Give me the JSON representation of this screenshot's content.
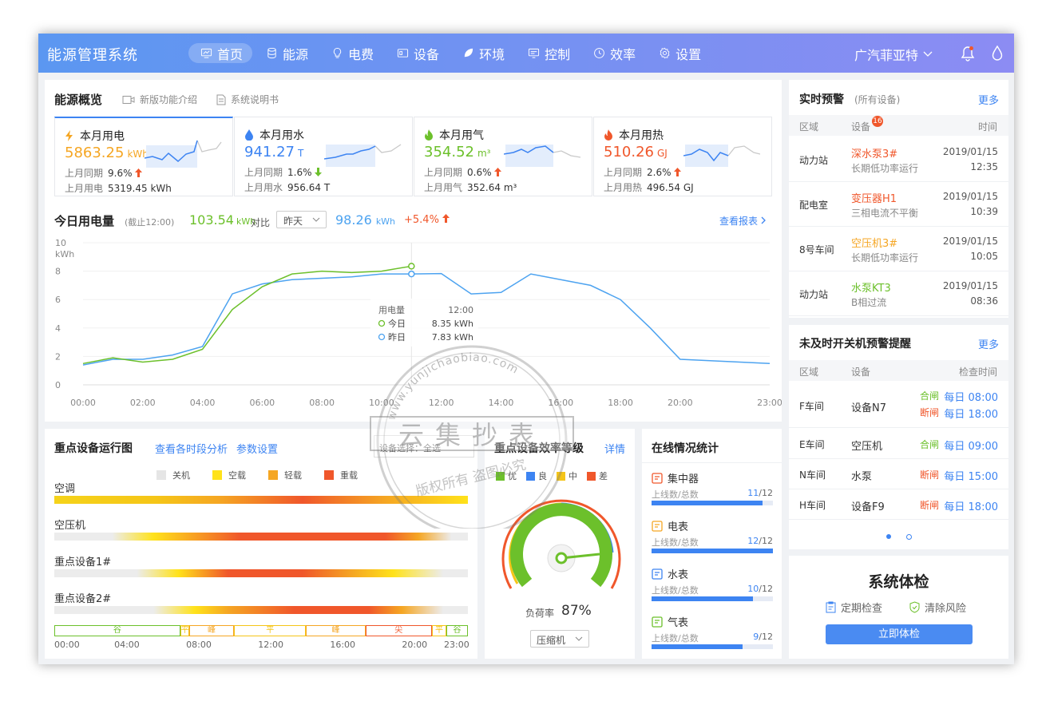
{
  "app": {
    "title": "能源管理系统",
    "user": "广汽菲亚特"
  },
  "nav": [
    "首页",
    "能源",
    "电费",
    "设备",
    "环境",
    "控制",
    "效率",
    "设置"
  ],
  "overview": {
    "title": "能源概览",
    "links": [
      "新版功能介绍",
      "系统说明书"
    ],
    "stats": [
      {
        "title": "本月用电",
        "value": "5863.25",
        "unit": "kWh",
        "color": "#f5a623",
        "yoy_label": "上月同期",
        "yoy": "9.6%",
        "yoy_dir": "up",
        "prev_label": "上月用电",
        "prev": "5319.45 kWh"
      },
      {
        "title": "本月用水",
        "value": "941.27",
        "unit": "T",
        "color": "#3d84f2",
        "yoy_label": "上月同期",
        "yoy": "1.6%",
        "yoy_dir": "down",
        "prev_label": "上月用水",
        "prev": "956.64 T"
      },
      {
        "title": "本月用气",
        "value": "354.52",
        "unit": "m³",
        "color": "#6cc02b",
        "yoy_label": "上月同期",
        "yoy": "0.6%",
        "yoy_dir": "up",
        "prev_label": "上月用气",
        "prev": "352.64 m³"
      },
      {
        "title": "本月用热",
        "value": "510.26",
        "unit": "GJ",
        "color": "#f0572b",
        "yoy_label": "上月同期",
        "yoy": "2.6%",
        "yoy_dir": "up",
        "prev_label": "上月用热",
        "prev": "496.54 GJ"
      }
    ]
  },
  "today": {
    "title": "今日用电量",
    "asof": "(截止12:00)",
    "today_val": "103.54",
    "unit": "kWh",
    "compare": "对比",
    "select": "昨天",
    "yest_val": "98.26",
    "pct": "+5.4%",
    "report": "查看报表"
  },
  "chart_data": {
    "type": "line",
    "ylabel": "kWh",
    "ylim": [
      0,
      10
    ],
    "yticks": [
      0,
      2,
      4,
      6,
      8,
      10
    ],
    "x": [
      "00:00",
      "01:00",
      "02:00",
      "03:00",
      "04:00",
      "05:00",
      "06:00",
      "07:00",
      "08:00",
      "09:00",
      "10:00",
      "11:00",
      "12:00",
      "13:00",
      "14:00",
      "15:00",
      "16:00",
      "17:00",
      "18:00",
      "19:00",
      "20:00",
      "21:00",
      "22:00",
      "23:00"
    ],
    "xticks": [
      "00:00",
      "02:00",
      "04:00",
      "06:00",
      "08:00",
      "10:00",
      "12:00",
      "14:00",
      "16:00",
      "18:00",
      "20:00",
      "23:00"
    ],
    "series": [
      {
        "name": "今日",
        "color": "#6cc02b",
        "values": [
          1.5,
          1.9,
          1.6,
          1.8,
          2.5,
          5.3,
          6.9,
          7.8,
          8.0,
          7.9,
          8.0,
          8.35
        ]
      },
      {
        "name": "昨日",
        "color": "#4da3f0",
        "values": [
          1.4,
          1.8,
          1.8,
          2.1,
          2.7,
          6.4,
          7.1,
          7.4,
          7.5,
          7.6,
          7.8,
          7.8,
          7.83,
          6.4,
          6.5,
          7.8,
          7.4,
          7.0,
          6.0,
          4.0,
          1.8,
          1.7,
          1.6,
          1.5
        ]
      }
    ],
    "tooltip": {
      "title": "用电量",
      "time": "12:00",
      "rows": [
        {
          "name": "今日",
          "value": "8.35 kWh"
        },
        {
          "name": "昨日",
          "value": "7.83 kWh"
        }
      ]
    }
  },
  "runmap": {
    "title": "重点设备运行图",
    "link1": "查看各时段分析",
    "link2": "参数设置",
    "select": "设备选择：全选",
    "legend": [
      {
        "name": "关机",
        "color": "#e5e5e5"
      },
      {
        "name": "空载",
        "color": "#ffe21a"
      },
      {
        "name": "轻载",
        "color": "#f5a623"
      },
      {
        "name": "重载",
        "color": "#f0572b"
      }
    ],
    "devices": [
      "空调",
      "空压机",
      "重点设备1#",
      "重点设备2#"
    ],
    "segments": [
      "谷",
      "平",
      "峰",
      "平",
      "峰",
      "尖",
      "平",
      "谷"
    ],
    "times": [
      "00:00",
      "04:00",
      "08:00",
      "12:00",
      "16:00",
      "20:00",
      "23:00"
    ]
  },
  "efficiency": {
    "title": "重点设备效率等级",
    "link": "详情",
    "legend": [
      {
        "name": "优",
        "color": "#6cc02b"
      },
      {
        "name": "良",
        "color": "#3d84f2"
      },
      {
        "name": "中",
        "color": "#f5c518"
      },
      {
        "name": "差",
        "color": "#f0572b"
      }
    ],
    "load_label": "负荷率",
    "load": "87%",
    "load_value": 0.87,
    "select": "压缩机"
  },
  "online": {
    "title": "在线情况统计",
    "sublabel": "上线数/总数",
    "items": [
      {
        "name": "集中器",
        "online": "11",
        "total": "12",
        "ratio": 0.917
      },
      {
        "name": "电表",
        "online": "12",
        "total": "12",
        "ratio": 1.0
      },
      {
        "name": "水表",
        "online": "10",
        "total": "12",
        "ratio": 0.833
      },
      {
        "name": "气表",
        "online": "9",
        "total": "12",
        "ratio": 0.75
      }
    ]
  },
  "alerts": {
    "title": "实时预警",
    "scope": "(所有设备)",
    "more": "更多",
    "cols": [
      "区域",
      "设备",
      "时间"
    ],
    "badge": "16",
    "rows": [
      {
        "area": "动力站",
        "device": "深水泵3#",
        "color": "#f0572b",
        "desc": "长期低功率运行",
        "date": "2019/01/15",
        "time": "12:35"
      },
      {
        "area": "配电室",
        "device": "变压器H1",
        "color": "#f0572b",
        "desc": "三相电流不平衡",
        "date": "2019/01/15",
        "time": "10:39"
      },
      {
        "area": "8号车间",
        "device": "空压机3#",
        "color": "#f5a623",
        "desc": "长期低功率运行",
        "date": "2019/01/15",
        "time": "10:05"
      },
      {
        "area": "动力站",
        "device": "水泵KT3",
        "color": "#6cc02b",
        "desc": "B相过流",
        "date": "2019/01/15",
        "time": "08:36"
      }
    ]
  },
  "switchwarn": {
    "title": "未及时开关机预警提醒",
    "more": "更多",
    "cols": [
      "区域",
      "设备",
      "检查时间"
    ],
    "rows": [
      {
        "area": "F车间",
        "device": "设备N7",
        "checks": [
          {
            "label": "合闸",
            "color": "#6cc02b",
            "time": "每日 08:00"
          },
          {
            "label": "断闸",
            "color": "#f0572b",
            "time": "每日 18:00"
          }
        ]
      },
      {
        "area": "E车间",
        "device": "空压机",
        "checks": [
          {
            "label": "合闸",
            "color": "#6cc02b",
            "time": "每日 09:00"
          }
        ]
      },
      {
        "area": "N车间",
        "device": "水泵",
        "checks": [
          {
            "label": "断闸",
            "color": "#f0572b",
            "time": "每日 15:00"
          }
        ]
      },
      {
        "area": "H车间",
        "device": "设备F9",
        "checks": [
          {
            "label": "断闸",
            "color": "#f0572b",
            "time": "每日 18:00"
          }
        ]
      }
    ]
  },
  "checkup": {
    "title": "系统体检",
    "items": [
      "定期检查",
      "清除风险"
    ],
    "button": "立即体检"
  },
  "watermark": {
    "site": "www.yunjichaobiao.com",
    "brand": "云集抄表",
    "slogan": "版权所有 盗图必究"
  }
}
